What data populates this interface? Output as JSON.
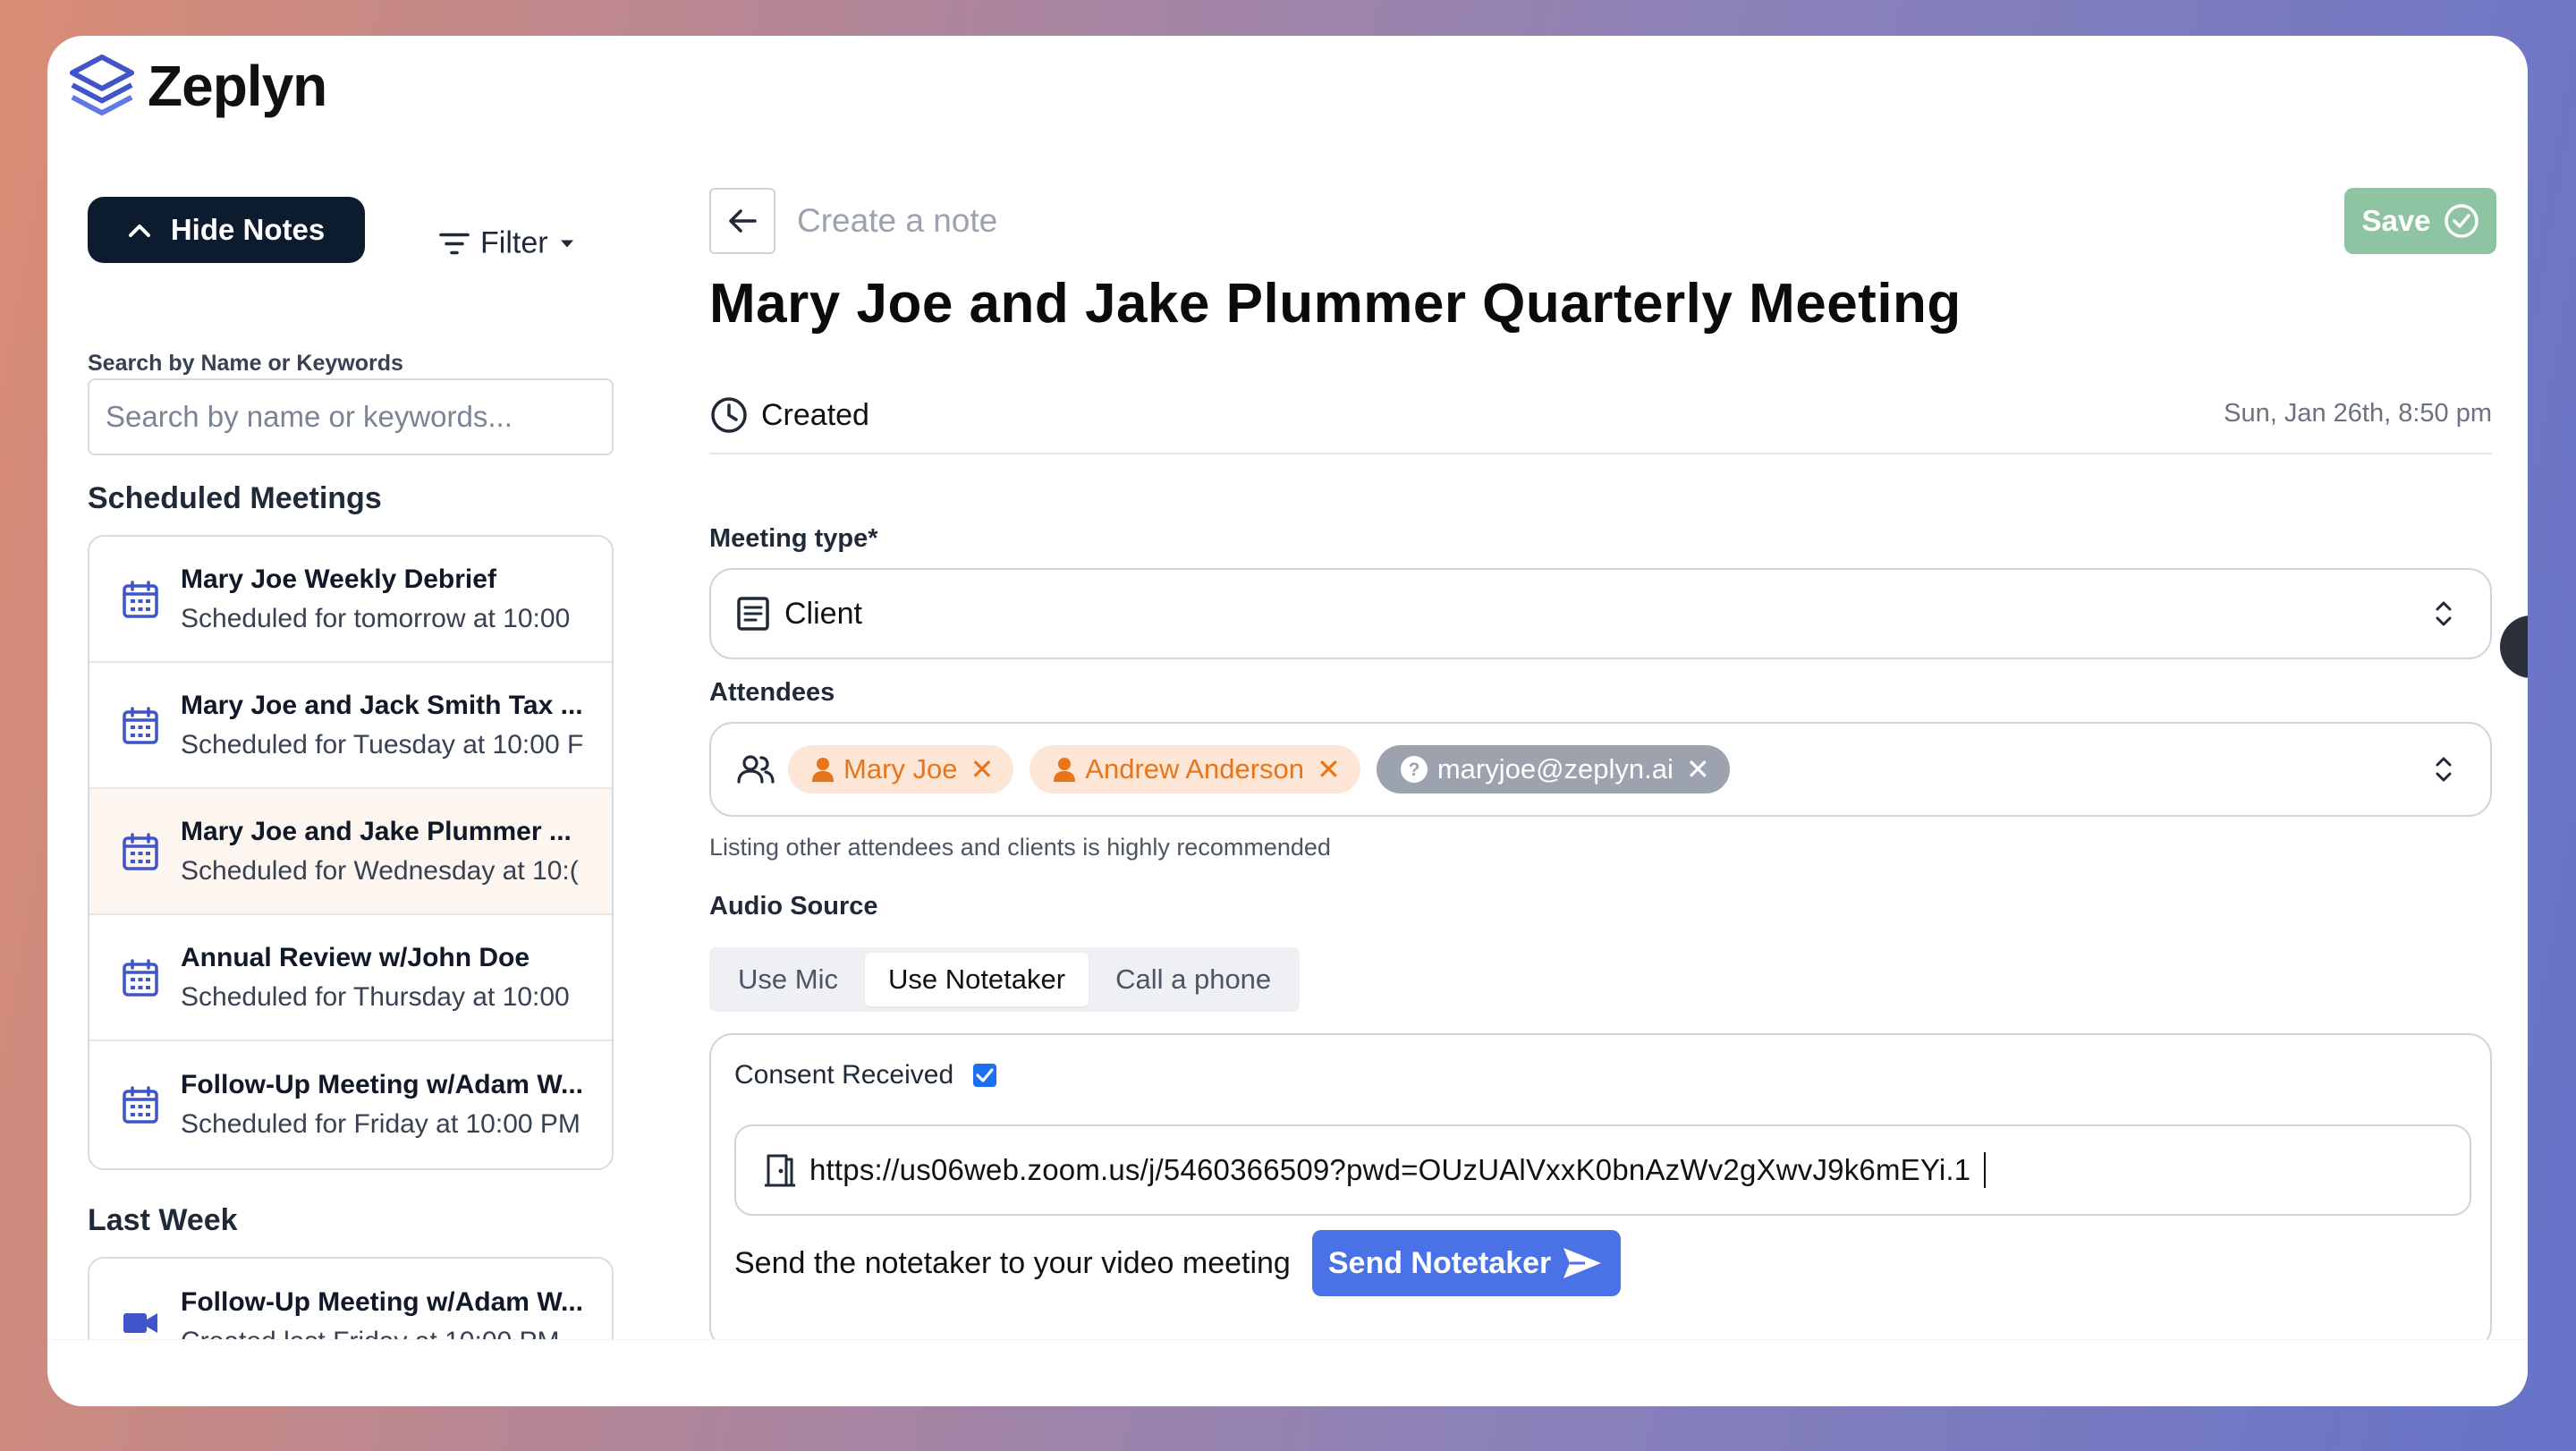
{
  "app": {
    "logo_text": "Zeplyn"
  },
  "sidebar": {
    "hide_notes_label": "Hide Notes",
    "filter_label": "Filter",
    "search": {
      "label": "Search by Name or Keywords",
      "placeholder": "Search by name or keywords..."
    },
    "scheduled_title": "Scheduled Meetings",
    "scheduled": [
      {
        "title": "Mary Joe Weekly Debrief",
        "subtitle": "Scheduled for tomorrow at 10:00"
      },
      {
        "title": "Mary Joe and Jack Smith Tax ...",
        "subtitle": "Scheduled for Tuesday at 10:00 F"
      },
      {
        "title": "Mary Joe and Jake Plummer ...",
        "subtitle": "Scheduled for Wednesday at 10:("
      },
      {
        "title": "Annual Review w/John Doe",
        "subtitle": "Scheduled for Thursday at 10:00"
      },
      {
        "title": "Follow-Up Meeting w/Adam W...",
        "subtitle": "Scheduled for Friday at 10:00 PM"
      }
    ],
    "last_week_title": "Last Week",
    "last_week": [
      {
        "title": "Follow-Up Meeting w/Adam W...",
        "subtitle": "Created last Friday at 10:00 PM"
      }
    ]
  },
  "main": {
    "breadcrumb": "Create a note",
    "save_label": "Save",
    "title": "Mary Joe and Jake Plummer Quarterly Meeting",
    "status": "Created",
    "date": "Sun, Jan 26th, 8:50 pm",
    "meeting_type": {
      "label": "Meeting type*",
      "value": "Client"
    },
    "attendees": {
      "label": "Attendees",
      "chips": [
        {
          "name": "Mary Joe",
          "kind": "user"
        },
        {
          "name": "Andrew Anderson",
          "kind": "user"
        },
        {
          "name": "maryjoe@zeplyn.ai",
          "kind": "unknown"
        }
      ],
      "hint": "Listing other attendees and clients is highly recommended"
    },
    "audio_source": {
      "label": "Audio Source",
      "options": [
        "Use Mic",
        "Use Notetaker",
        "Call a phone"
      ],
      "selected": "Use Notetaker"
    },
    "notetaker": {
      "consent_label": "Consent Received",
      "consent_checked": true,
      "url": "https://us06web.zoom.us/j/5460366509?pwd=OUzUAlVxxK0bnAzWv2gXwvJ9k6mEYi.1",
      "send_text": "Send the notetaker to your video meeting",
      "send_label": "Send Notetaker"
    }
  },
  "colors": {
    "primary_dark": "#0d1b2e",
    "save_green": "#8fc4a2",
    "send_blue": "#4a72e6",
    "chip_orange_bg": "#fde6d6",
    "chip_orange_text": "#e8751a",
    "calendar_icon": "#3f55c9"
  }
}
